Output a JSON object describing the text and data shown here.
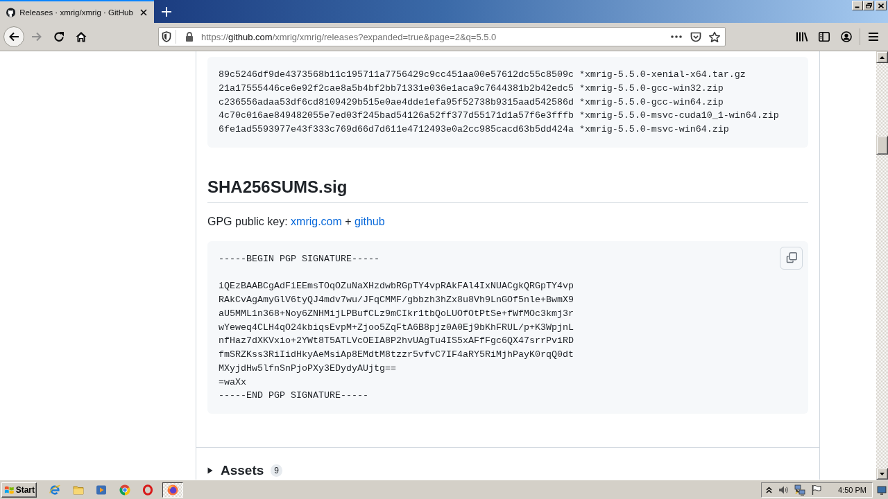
{
  "window": {
    "controls": [
      {
        "kind": "minimize"
      },
      {
        "kind": "restore"
      },
      {
        "kind": "close"
      }
    ]
  },
  "tabs": [
    {
      "title": "Releases · xmrig/xmrig · GitHub",
      "selected": true
    }
  ],
  "toolbar": {
    "nav_buttons": [
      {
        "kind": "back",
        "disabled": false
      },
      {
        "kind": "forward",
        "disabled": true
      },
      {
        "kind": "reload",
        "disabled": false
      },
      {
        "kind": "home",
        "disabled": false
      }
    ],
    "address": {
      "scheme": "https://",
      "host": "github.com",
      "path": "/xmrig/xmrig/releases?expanded=true&page=2&q=5.5.0"
    },
    "address_actions": [
      {
        "kind": "more"
      },
      {
        "kind": "pocket"
      },
      {
        "kind": "bookmark"
      }
    ],
    "tools": [
      {
        "kind": "library"
      },
      {
        "kind": "sidebar"
      },
      {
        "kind": "account"
      },
      {
        "kind": "menu"
      }
    ]
  },
  "release": {
    "checksums": {
      "lines": [
        "89c5246df9de4373568b11c195711a7756429c9cc451aa00e57612dc55c8509c *xmrig-5.5.0-xenial-x64.tar.gz",
        "21a17555446ce6e92f2cae8a5b4bf2bb71331e036e1aca9c7644381b2b42edc5 *xmrig-5.5.0-gcc-win32.zip",
        "c236556adaa53df6cd8109429b515e0ae4dde1efa95f52738b9315aad542586d *xmrig-5.5.0-gcc-win64.zip",
        "4c70c016ae849482055e7ed03f245bad54126a52ff377d55171d1a57f6e3fffb *xmrig-5.5.0-msvc-cuda10_1-win64.zip",
        "6fe1ad5593977e43f333c769d66d7d611e4712493e0a2cc985cacd63b5dd424a *xmrig-5.5.0-msvc-win64.zip"
      ]
    },
    "signature_file": {
      "heading": "SHA256SUMS.sig",
      "key_label": "GPG public key:",
      "key_links": [
        "xmrig.com",
        "github"
      ],
      "key_separator": "+",
      "signature": {
        "copy_button": true,
        "begin": "-----BEGIN PGP SIGNATURE-----",
        "body": [
          "iQEzBAABCgAdFiEEmsTOqOZuNaXHzdwbRGpTY4vpRAkFAl4IxNUACgkQRGpTY4vp",
          "RAkCvAgAmyGlV6tyQJ4mdv7wu/JFqCMMF/gbbzh3hZx8u8Vh9LnGOf5nle+BwmX9",
          "aU5MML1n368+Noy6ZNHMijLPBufCLz9mCIkr1tbQoLUOfOtPtSe+fWfMOc3kmj3r",
          "wYeweq4CLH4qO24kbiqsEvpM+Zjoo5ZqFtA6B8pjz0A0Ej9bKhFRUL/p+K3WpjnL",
          "nfHaz7dXKVxio+2YWt8T5ATLVcOEIA8P2hvUAgTu4IS5xAFfFgc6QX47srrPviRD",
          "fmSRZKss3RiIidHkyAeMsiAp8EMdtM8tzzr5vfvC7IF4aRY5RiMjhPayK0rqQ0dt",
          "MXyjdHw5lfnSnPjoPXy3EDydyAUjtg=="
        ],
        "checksum": "=waXx",
        "end": "-----END PGP SIGNATURE-----"
      }
    },
    "assets": {
      "label": "Assets",
      "count": "9",
      "expanded": false
    }
  },
  "taskbar": {
    "start_label": "Start",
    "quick_launch": [
      {
        "kind": "ie"
      },
      {
        "kind": "explorer"
      },
      {
        "kind": "media"
      },
      {
        "kind": "chrome"
      },
      {
        "kind": "opera"
      }
    ],
    "tasks": [
      {
        "kind": "firefox",
        "selected": true
      }
    ],
    "tray": [
      {
        "kind": "expand"
      },
      {
        "kind": "volume"
      },
      {
        "kind": "network"
      },
      {
        "kind": "action-center"
      }
    ],
    "clock": "4:50 PM"
  }
}
